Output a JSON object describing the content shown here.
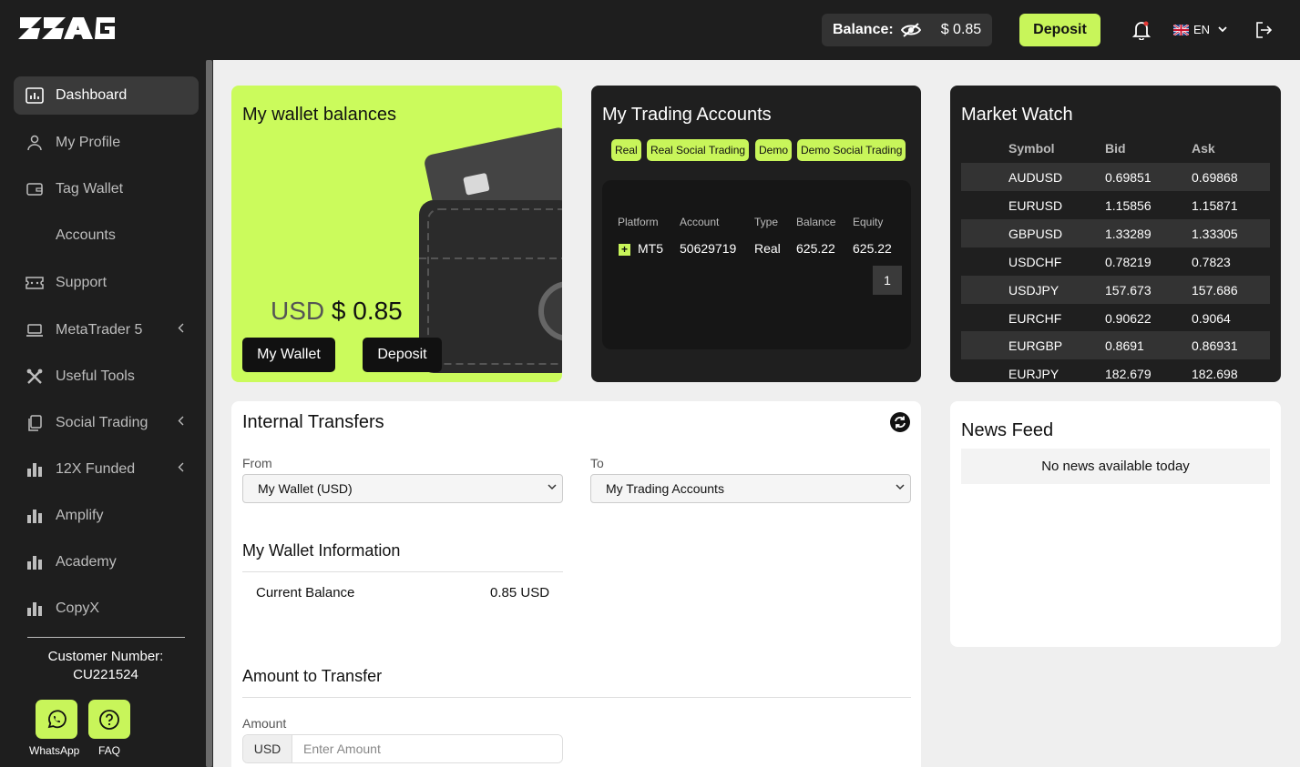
{
  "header": {
    "logo_text": "ZAG",
    "balance_label": "Balance:",
    "balance_value": "$ 0.85",
    "deposit_label": "Deposit",
    "language": "EN"
  },
  "sidebar": {
    "items": [
      {
        "label": "Dashboard",
        "icon": "dashboard-icon",
        "active": true
      },
      {
        "label": "My Profile",
        "icon": "user-icon"
      },
      {
        "label": "Tag Wallet",
        "icon": "wallet-icon"
      },
      {
        "label": "Accounts",
        "icon": ""
      },
      {
        "label": "Support",
        "icon": "ticket-icon"
      },
      {
        "label": "MetaTrader 5",
        "icon": "laptop-icon",
        "expandable": true
      },
      {
        "label": "Useful Tools",
        "icon": "tools-icon"
      },
      {
        "label": "Social Trading",
        "icon": "copy-icon",
        "expandable": true
      },
      {
        "label": "12X Funded",
        "icon": "bar-chart-icon",
        "expandable": true
      },
      {
        "label": "Amplify",
        "icon": "bar-chart-icon"
      },
      {
        "label": "Academy",
        "icon": "bar-chart-icon"
      },
      {
        "label": "CopyX",
        "icon": "bar-chart-icon"
      }
    ],
    "customer_label": "Customer Number:",
    "customer_number": "CU221524",
    "whatsapp_label": "WhatsApp",
    "faq_label": "FAQ"
  },
  "wallet": {
    "title": "My wallet balances",
    "currency": "USD",
    "amount": "$ 0.85",
    "my_wallet_button": "My Wallet",
    "deposit_button": "Deposit"
  },
  "trading": {
    "title": "My Trading Accounts",
    "filters": [
      "Real",
      "Real Social Trading",
      "Demo",
      "Demo Social Trading"
    ],
    "columns": [
      "Platform",
      "Account",
      "Type",
      "Balance",
      "Equity"
    ],
    "rows": [
      {
        "platform": "MT5",
        "account": "50629719",
        "type": "Real",
        "balance": "625.22",
        "equity": "625.22"
      }
    ],
    "page": "1"
  },
  "market": {
    "title": "Market Watch",
    "columns": [
      "Symbol",
      "Bid",
      "Ask"
    ],
    "rows": [
      [
        "AUDUSD",
        "0.69851",
        "0.69868"
      ],
      [
        "EURUSD",
        "1.15856",
        "1.15871"
      ],
      [
        "GBPUSD",
        "1.33289",
        "1.33305"
      ],
      [
        "USDCHF",
        "0.78219",
        "0.7823"
      ],
      [
        "USDJPY",
        "157.673",
        "157.686"
      ],
      [
        "EURCHF",
        "0.90622",
        "0.9064"
      ],
      [
        "EURGBP",
        "0.8691",
        "0.86931"
      ],
      [
        "EURJPY",
        "182.679",
        "182.698"
      ]
    ]
  },
  "transfers": {
    "title": "Internal Transfers",
    "from_label": "From",
    "from_value": "My Wallet (USD)",
    "to_label": "To",
    "to_value": "My Trading Accounts",
    "wallet_info_title": "My Wallet Information",
    "current_balance_label": "Current Balance",
    "current_balance_value": "0.85 USD",
    "amount_title": "Amount to Transfer",
    "amount_label": "Amount",
    "amount_currency": "USD",
    "amount_placeholder": "Enter Amount"
  },
  "news": {
    "title": "News Feed",
    "empty_text": "No news available today"
  },
  "colors": {
    "accent": "#c8f55a",
    "dark": "#1e1e1e"
  }
}
